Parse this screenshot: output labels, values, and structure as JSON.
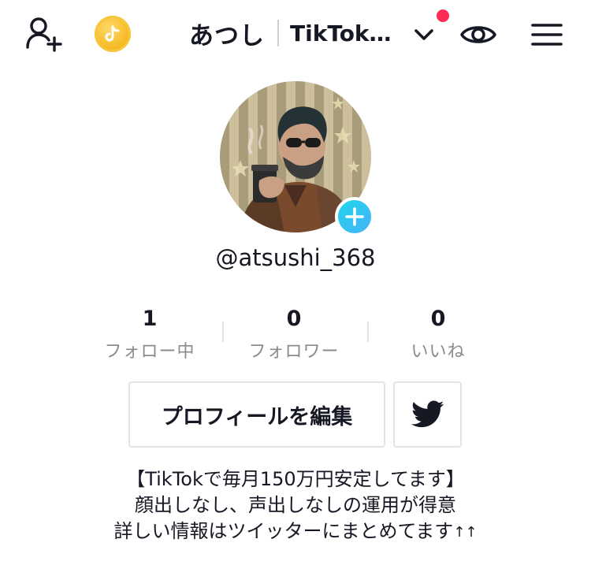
{
  "header": {
    "display_name": "あつし",
    "account_switcher": "TikTok…",
    "notification_dot_color": "#fe2c55",
    "icons": [
      "add-friend-icon",
      "tiktok-coin-icon",
      "chevron-down-icon",
      "eye-icon",
      "hamburger-menu-icon"
    ]
  },
  "profile": {
    "username": "@atsushi_368",
    "accent_color": "#20d5ec"
  },
  "stats": [
    {
      "value": "1",
      "label": "フォロー中"
    },
    {
      "value": "0",
      "label": "フォロワー"
    },
    {
      "value": "0",
      "label": "いいね"
    }
  ],
  "actions": {
    "edit_profile": "プロフィールを編集",
    "twitter_icon": "twitter-bird-icon"
  },
  "bio": {
    "line1": "【TikTokで毎月150万円安定してます】",
    "line2": "顔出しなし、声出しなしの運用が得意",
    "line3": "詳しい情報はツイッターにまとめてます",
    "line3_suffix": "↑↑"
  }
}
